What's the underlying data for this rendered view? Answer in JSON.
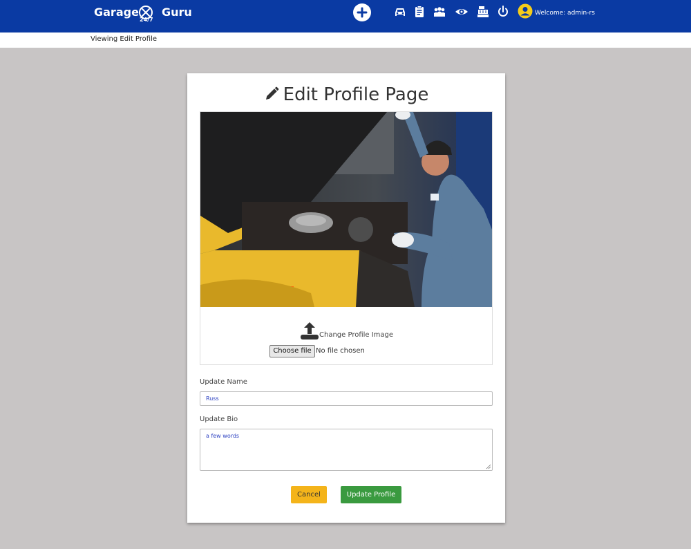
{
  "brand": {
    "name_left": "Garage",
    "name_right": "Guru",
    "tagline": "24/7"
  },
  "nav": {
    "icons": [
      "plus-circle-icon",
      "car-icon",
      "clipboard-icon",
      "users-icon",
      "eye-icon",
      "cash-register-icon",
      "power-icon"
    ],
    "welcome_text": "Welcome: admin-rs"
  },
  "breadcrumb": "Viewing Edit Profile",
  "page": {
    "title": "Edit Profile Page",
    "change_image_label": "Change Profile Image",
    "file_button_label": "Choose file",
    "file_status": "No file chosen",
    "name_label": "Update Name",
    "name_value": "Russ",
    "bio_label": "Update Bio",
    "bio_value": "a few words",
    "cancel_label": "Cancel",
    "update_label": "Update Profile"
  },
  "colors": {
    "navbar": "#0a3aa3",
    "cancel": "#f4b41a",
    "update": "#3a9a3f",
    "background": "#c8c5c5",
    "input_text": "#2a3fc1"
  }
}
